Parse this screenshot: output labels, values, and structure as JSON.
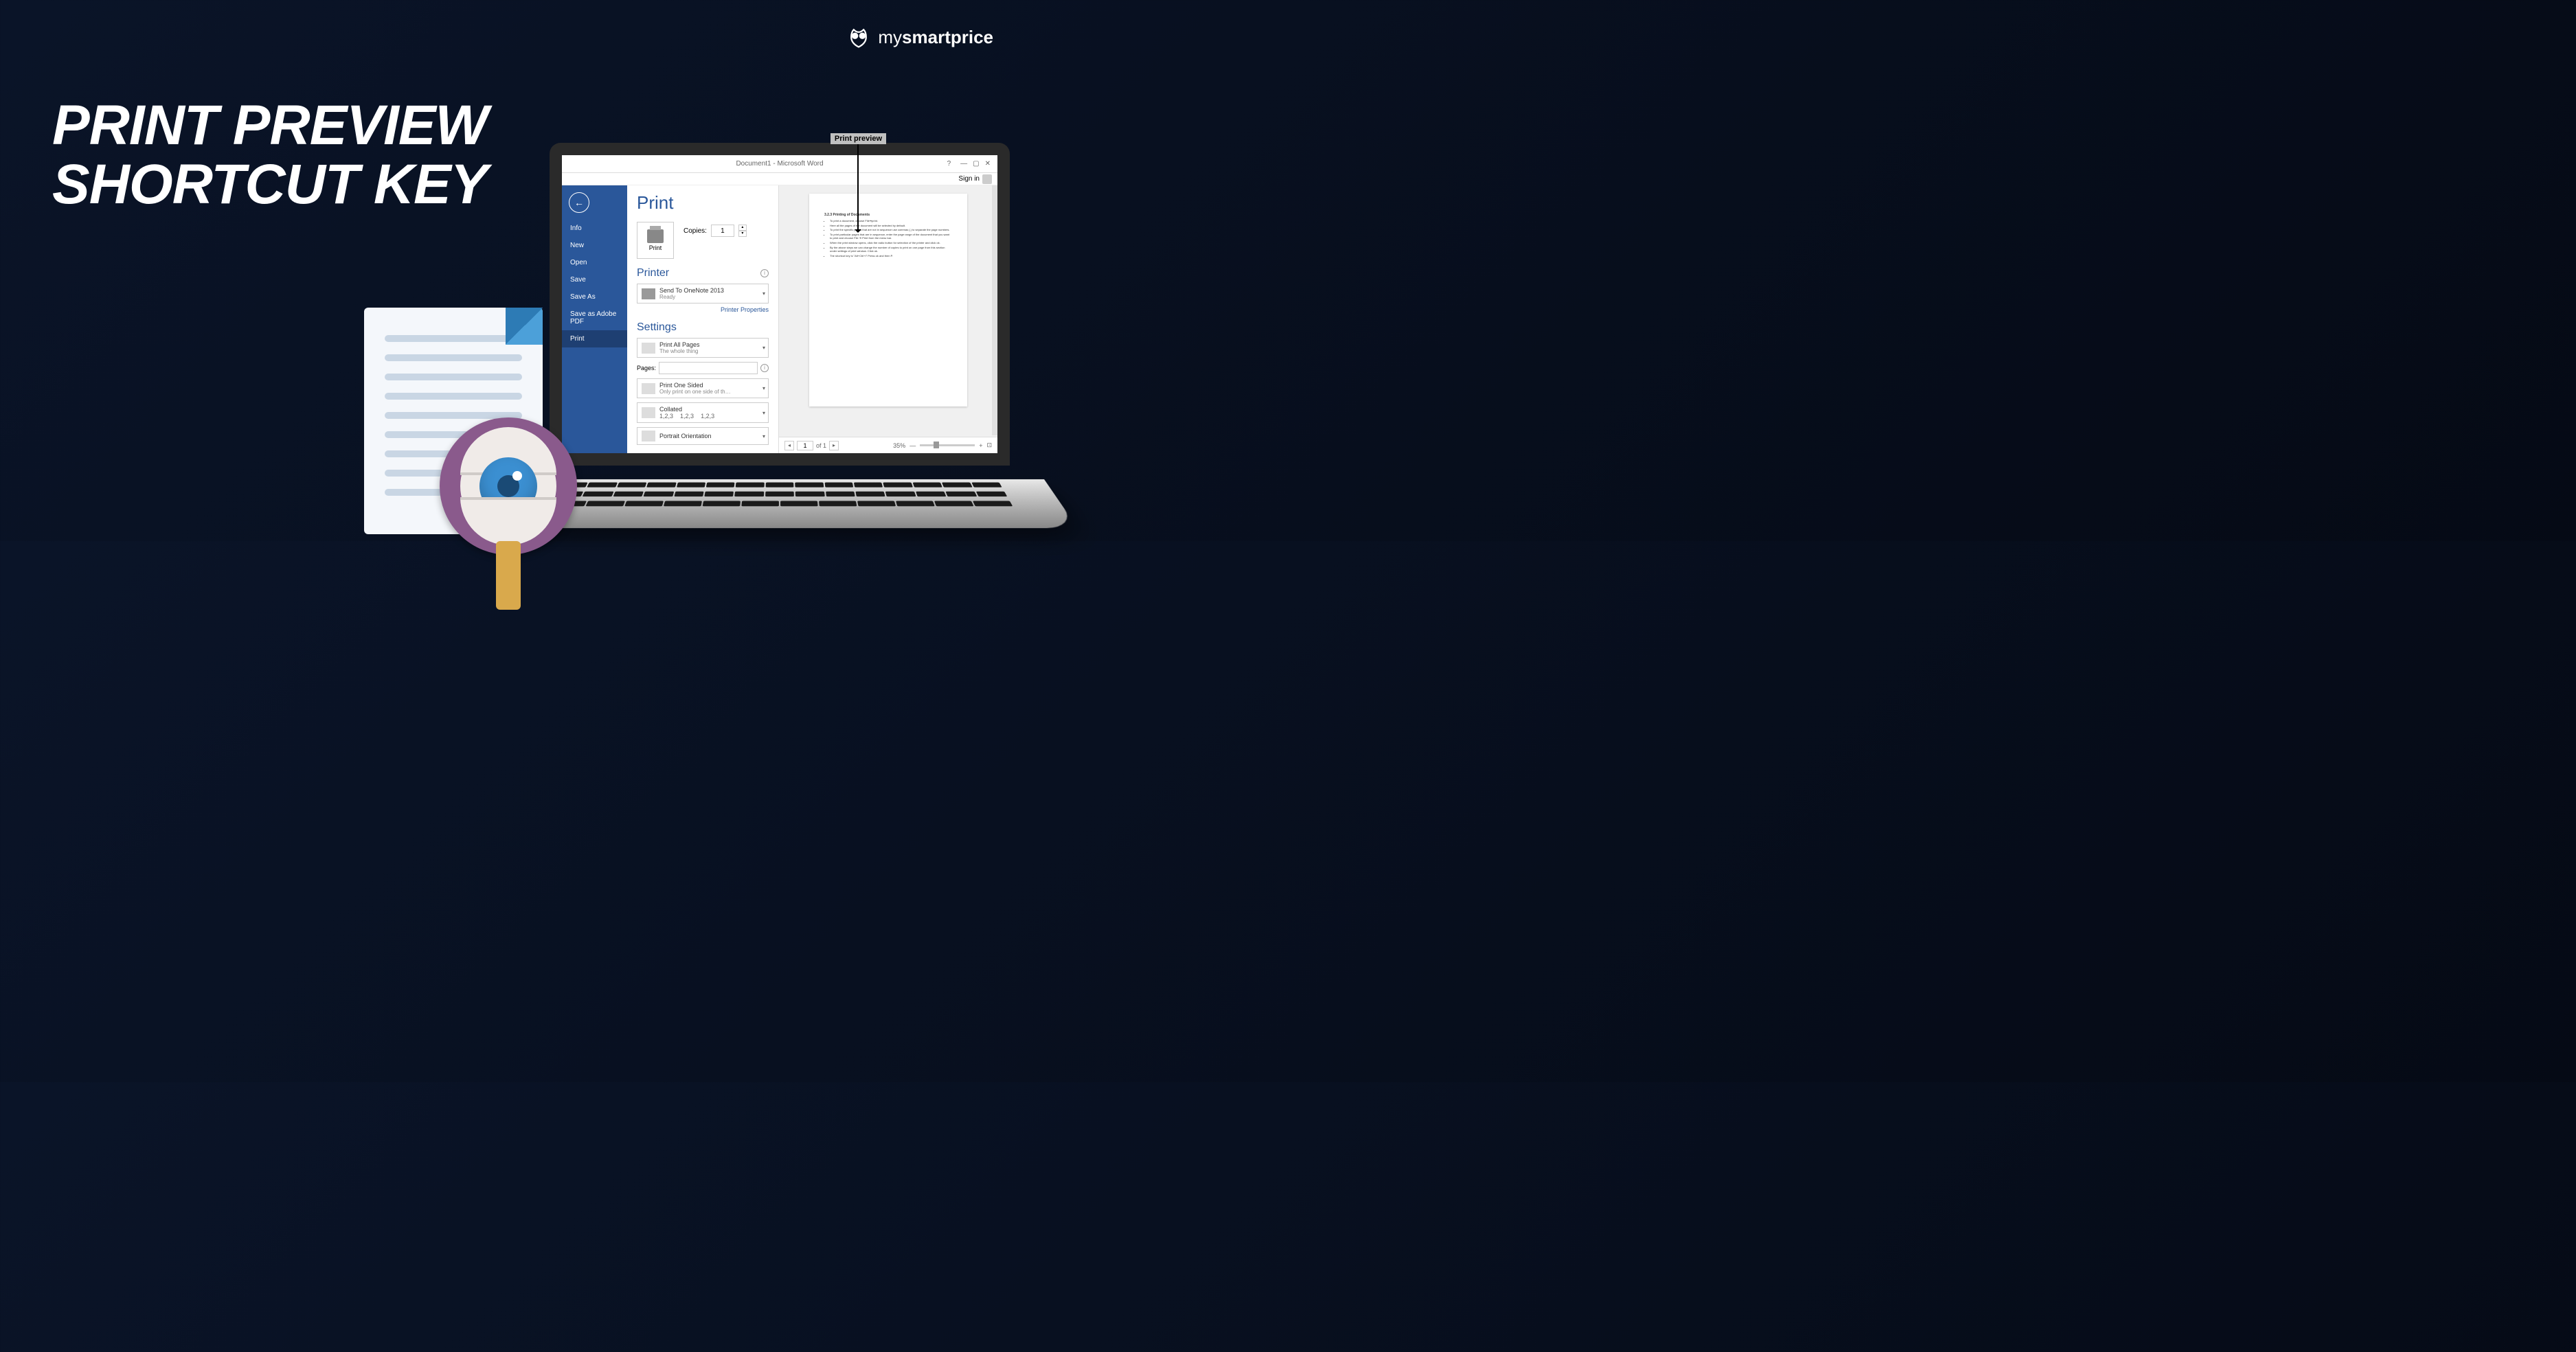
{
  "hero": {
    "line1": "PRINT PREVIEW",
    "line2": "SHORTCUT KEY"
  },
  "logo": {
    "brand_light": "my",
    "brand_bold": "smartprice"
  },
  "callout": {
    "label": "Print preview"
  },
  "titlebar": {
    "title": "Document1 - Microsoft Word",
    "help": "?",
    "signin": "Sign in"
  },
  "sidebar": {
    "items": [
      "Info",
      "New",
      "Open",
      "Save",
      "Save As",
      "Save as Adobe PDF",
      "Print"
    ]
  },
  "print": {
    "heading": "Print",
    "button": "Print",
    "copies_label": "Copies:",
    "copies_value": "1",
    "printer_heading": "Printer",
    "printer_name": "Send To OneNote 2013",
    "printer_status": "Ready",
    "printer_props": "Printer Properties",
    "settings_heading": "Settings",
    "opt_pages": "Print All Pages",
    "opt_pages_sub": "The whole thing",
    "pages_label": "Pages:",
    "opt_sided": "Print One Sided",
    "opt_sided_sub": "Only print on one side of th…",
    "opt_collated": "Collated",
    "opt_collated_sub1": "1,2,3",
    "opt_collated_sub2": "1,2,3",
    "opt_collated_sub3": "1,2,3",
    "opt_orient": "Portrait Orientation"
  },
  "preview_doc": {
    "heading": "3.2.3 Printing of Documents",
    "bullets": [
      "To print a document, choose File➜print.",
      "Here all the pages of the document will be selected by default.",
      "To print the specific pages that are not in sequence use commas (,) to separate the page numbers.",
      "To print particular pages that are in sequence, enter the page range of the document that you want to print and choose File ➜ Print from the menu bar.",
      "When the print window opens, click the radio button for selection of the printer and click ok.",
      "By the above steps we can change the number of copies to print on one page from this section under settings of print window. Click ok.",
      "The shortcut key is \"Alt+Ctrl+I\" Press ok and then P."
    ]
  },
  "footer": {
    "page_current": "1",
    "page_of": "of 1",
    "zoom": "35%"
  }
}
